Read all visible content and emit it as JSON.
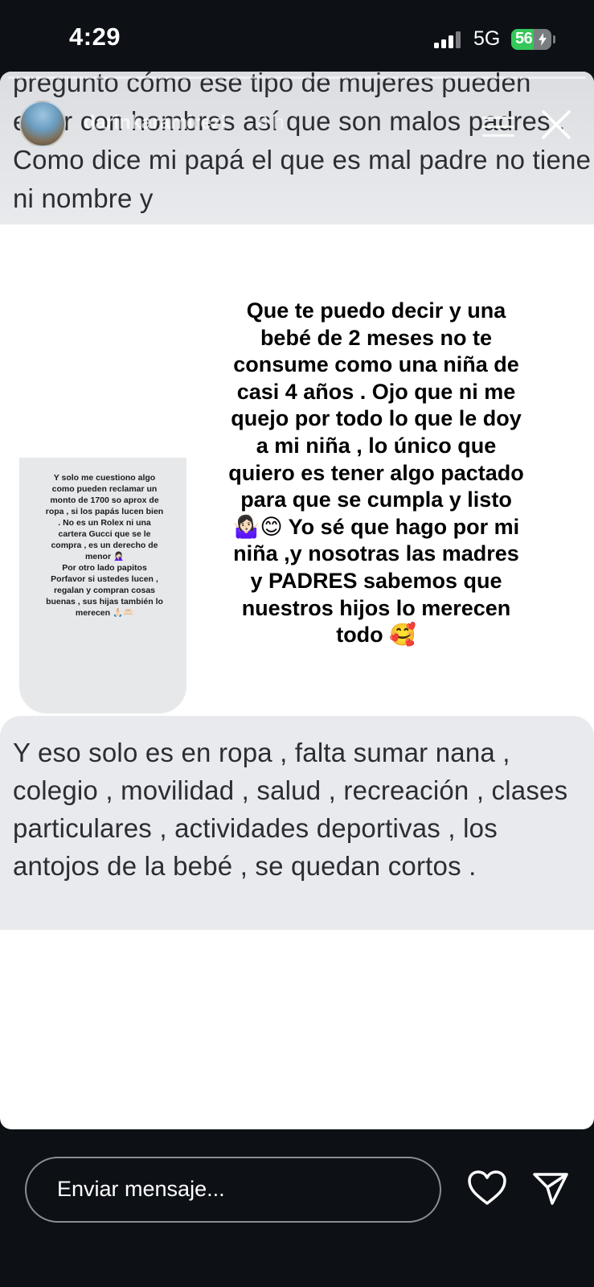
{
  "status_bar": {
    "time": "4:29",
    "network": "5G",
    "battery": "56",
    "battery_level_percent": 56
  },
  "story": {
    "username": "darinkaramirezl",
    "time_ago": "8 h",
    "top_text": "pregunto cómo ese tipo de mujeres pueden estar con hombres así que son malos padres . Como dice mi papá el que es mal padre no tiene ni nombre y",
    "screenshot_text": "Y solo me cuestiono algo como pueden reclamar un monto de 1700 so aprox de ropa , si los papás lucen bien . No es un Rolex ni una cartera Gucci que se le compra , es un derecho de menor 🤦🏻‍♀️\nPor otro lado papitos Porfavor si ustedes lucen , regalan y compran cosas buenas , sus hijas también lo merecen 🙏🏻🫶🏻",
    "main_text": "Que te puedo decir y una bebé de 2 meses no te consume como una niña de casi 4 años . Ojo que ni me quejo por todo lo que le doy a mi niña , lo único que quiero es tener algo pactado para que se cumpla y listo 🤷🏻‍♀️😊 Yo sé que hago por mi niña ,y nosotras las madres y PADRES sabemos que nuestros hijos lo merecen todo 🥰",
    "bottom_text": "Y eso solo es en ropa , falta sumar nana , colegio , movilidad , salud , recreación , clases particulares , actividades deportivas , los antojos de la bebé , se quedan cortos ."
  },
  "reply_bar": {
    "placeholder": "Enviar mensaje..."
  },
  "icons": {
    "more": "more-lines-icon",
    "close": "close-icon",
    "heart": "heart-icon",
    "send": "send-icon",
    "signal": "signal-icon"
  },
  "colors": {
    "background": "#0d1116",
    "battery_green": "#34c759",
    "text_box_background": "#e9eaed"
  }
}
